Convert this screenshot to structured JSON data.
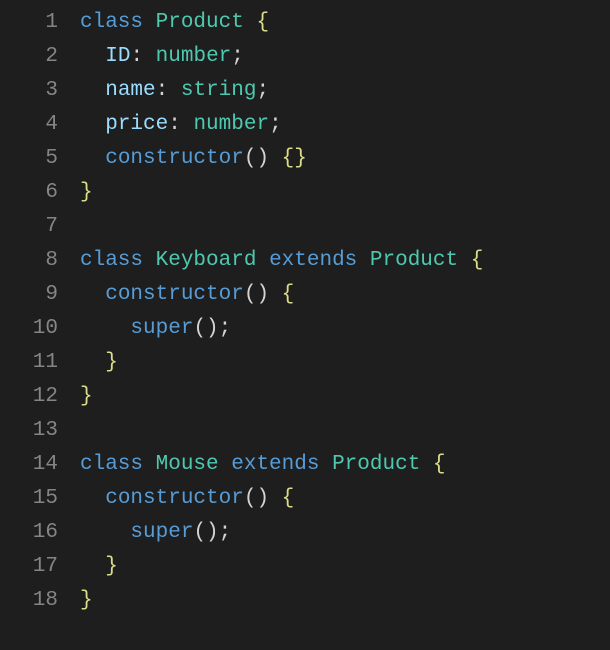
{
  "lineNumbers": [
    "1",
    "2",
    "3",
    "4",
    "5",
    "6",
    "7",
    "8",
    "9",
    "10",
    "11",
    "12",
    "13",
    "14",
    "15",
    "16",
    "17",
    "18"
  ],
  "tokens": {
    "class": "class",
    "extends": "extends",
    "Product": "Product",
    "Keyboard": "Keyboard",
    "Mouse": "Mouse",
    "ID": "ID",
    "name": "name",
    "price": "price",
    "number": "number",
    "string": "string",
    "constructor": "constructor",
    "super": "super",
    "colon": ":",
    "semicolon": ";",
    "parens": "()",
    "lparen": "(",
    "rparen": ")",
    "lbrace": "{",
    "rbrace": "}",
    "bracesEmpty": "{}",
    "space": " "
  }
}
